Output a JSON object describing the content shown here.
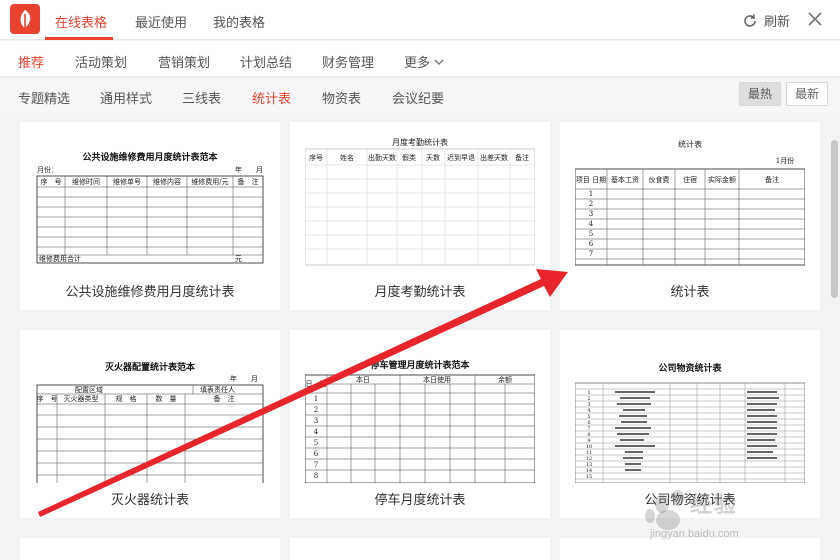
{
  "top_tabs": [
    "在线表格",
    "最近使用",
    "我的表格"
  ],
  "refresh_label": "刷新",
  "categories": [
    "推荐",
    "活动策划",
    "营销策划",
    "计划总结",
    "财务管理",
    "更多"
  ],
  "subcategories": [
    "专题精选",
    "通用样式",
    "三线表",
    "统计表",
    "物资表",
    "会议纪要"
  ],
  "sort": {
    "hot": "最热",
    "new": "最新"
  },
  "cards": [
    {
      "title": "公共设施维修费用月度统计表",
      "thumb_title": "公共设施维修费用月度统计表范本",
      "unit_label": "月份：",
      "year_label": "年　　月",
      "cols": [
        "序　号",
        "维修时间",
        "维修单号",
        "维修内容",
        "维修费用/元",
        "备　注"
      ],
      "footer_label": "维修费用合计",
      "footer_unit": "元"
    },
    {
      "title": "月度考勤统计表",
      "thumb_title": "月度考勤统计表",
      "cols": [
        "序号",
        "姓名",
        "出勤天数",
        "假类",
        "天数",
        "迟到早退",
        "出差天数",
        "备注"
      ]
    },
    {
      "title": "统计表",
      "thumb_title": "统计表",
      "month_label": "1月份",
      "cols": [
        "项目\n日期",
        "基本工资",
        "伙食费",
        "住宿",
        "实际金额",
        "备注"
      ],
      "rows": [
        "1",
        "2",
        "3",
        "4",
        "5",
        "6",
        "7"
      ]
    },
    {
      "title": "灭火器统计表",
      "thumb_title": "灭火器配置统计表范本",
      "date_label": "年　　月　　日",
      "area_label": "配置区域",
      "person_label": "填表责任人",
      "cols": [
        "序　号",
        "灭火器类型",
        "规　格",
        "数　量",
        "备　注"
      ]
    },
    {
      "title": "停车月度统计表",
      "thumb_title": "停车管理月度统计表范本",
      "col_date": "日　期",
      "group_a": "本日",
      "group_b": "本日使用",
      "group_c": "余额",
      "rows": [
        "1",
        "2",
        "3",
        "4",
        "5",
        "6",
        "7",
        "8"
      ]
    },
    {
      "title": "公司物资统计表",
      "thumb_title": "公司物资统计表",
      "rows": [
        "1",
        "2",
        "3",
        "4",
        "5",
        "6",
        "7",
        "8",
        "9",
        "10",
        "11",
        "12",
        "13",
        "14",
        "15"
      ]
    }
  ],
  "watermark": {
    "text": "经验",
    "url": "jingyan.baidu.com"
  },
  "colors": {
    "accent": "#e8432f",
    "arrow": "#e8252b"
  }
}
